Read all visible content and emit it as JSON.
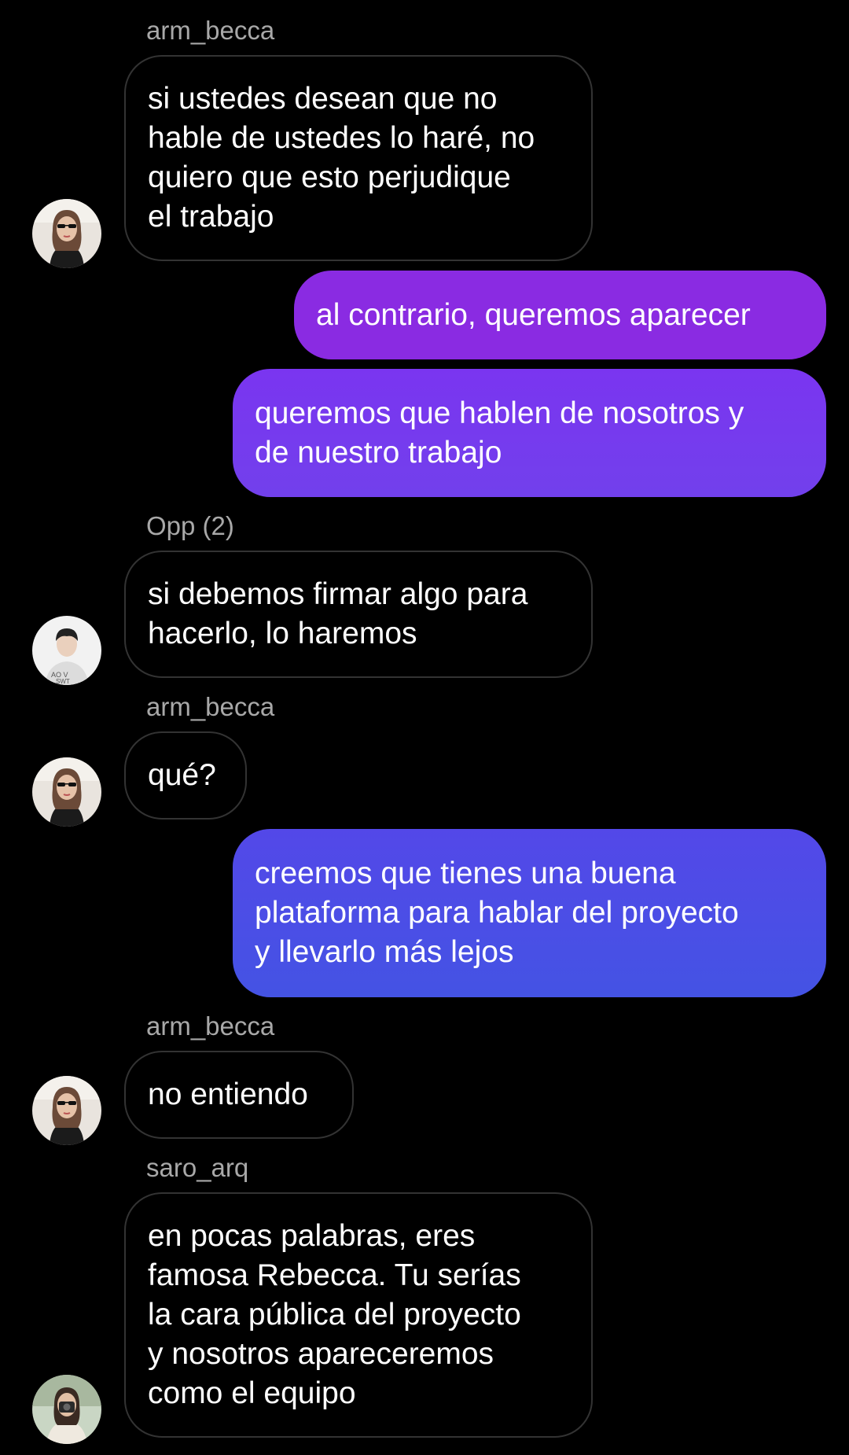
{
  "colors": {
    "background": "#000000",
    "incoming_border": "#333333",
    "sender_name": "#a8a8a8",
    "outgoing_purple": "#8a2be2",
    "outgoing_violet": "#7a3aee",
    "outgoing_blue": "#4a52e6"
  },
  "messages": [
    {
      "type": "incoming",
      "sender": "arm_becca",
      "text": "si ustedes desean que no\nhable de ustedes lo haré, no\nquiero que esto perjudique\nel trabajo",
      "avatar": "avatar-arm-becca"
    },
    {
      "type": "outgoing",
      "text": "al contrario, queremos aparecer"
    },
    {
      "type": "outgoing",
      "text": "queremos que hablen de nosotros y\nde nuestro trabajo"
    },
    {
      "type": "incoming",
      "sender": "Opp (2)",
      "text": "si debemos firmar algo para\nhacerlo, lo haremos",
      "avatar": "avatar-opp"
    },
    {
      "type": "incoming",
      "sender": "arm_becca",
      "text": "qué?",
      "avatar": "avatar-arm-becca"
    },
    {
      "type": "outgoing",
      "text": "creemos que tienes una buena\nplataforma para hablar del proyecto\ny llevarlo más lejos"
    },
    {
      "type": "incoming",
      "sender": "arm_becca",
      "text": "no entiendo",
      "avatar": "avatar-arm-becca"
    },
    {
      "type": "incoming",
      "sender": "saro_arq",
      "text": "en pocas palabras, eres\nfamosa Rebecca. Tu serías\nla cara pública del proyecto\ny nosotros apareceremos\ncomo el equipo",
      "avatar": "avatar-saro-arq"
    }
  ]
}
